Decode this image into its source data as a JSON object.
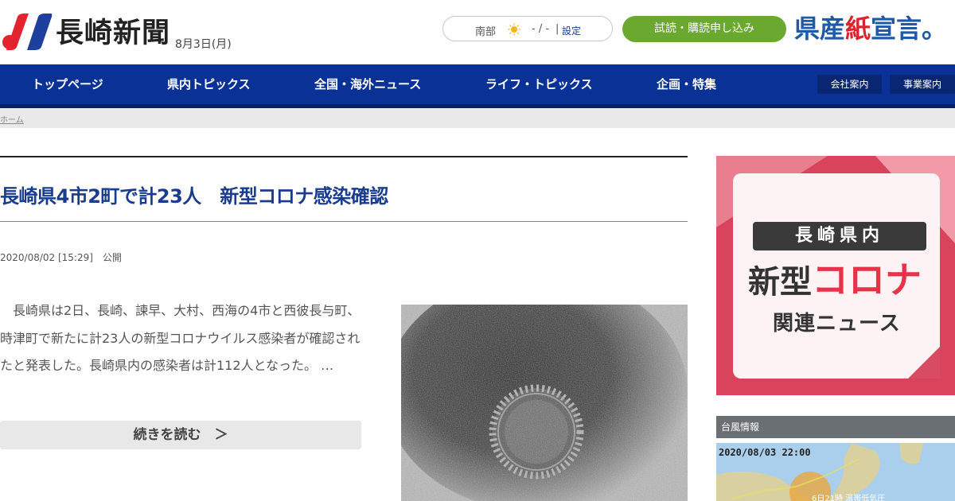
{
  "header": {
    "logo_text": "長崎新聞",
    "date": "8月3日(月)",
    "weather": {
      "region": "南部",
      "icon": "sun-icon",
      "temp": "- / -",
      "separator": "|",
      "settings": "設定"
    },
    "subscribe_label": "試読・購読申し込み",
    "campaign": {
      "part1": "県産",
      "part2": "紙",
      "part3": "宣言",
      "dot": "。"
    }
  },
  "nav": {
    "items": [
      {
        "label": "トップページ"
      },
      {
        "label": "県内トピックス"
      },
      {
        "label": "全国・海外ニュース"
      },
      {
        "label": "ライフ・トピックス"
      },
      {
        "label": "企画・特集"
      }
    ],
    "small": [
      {
        "label": "会社案内"
      },
      {
        "label": "事業案内"
      }
    ]
  },
  "breadcrumb": {
    "home": "ホーム"
  },
  "article": {
    "title": "長崎県4市2町で計23人　新型コロナ感染確認",
    "pubdate": "2020/08/02 [15:29]　公開",
    "summary": "　長崎県は2日、長崎、諫早、大村、西海の4市と西彼長与町、時津町で新たに計23人の新型コロナウイルス感染者が確認されたと発表した。長崎県内の感染者は計112人となった。 …",
    "read_more": "続きを読む　＞"
  },
  "sidebar": {
    "banner": {
      "tag": "長崎県内",
      "big_black": "新型",
      "big_red": "コロナ",
      "sub": "関連ニュース"
    },
    "typhoon": {
      "heading": "台風情報",
      "time": "2020/08/03 22:00",
      "note": "6日21時 温帯低気圧"
    }
  },
  "colors": {
    "nav_bg": "#0a3196",
    "title": "#1a3c8e",
    "subscribe": "#6aa830",
    "campaign_blue": "#1f5aa8",
    "campaign_red": "#d9232d",
    "banner_red": "#e5334a"
  }
}
